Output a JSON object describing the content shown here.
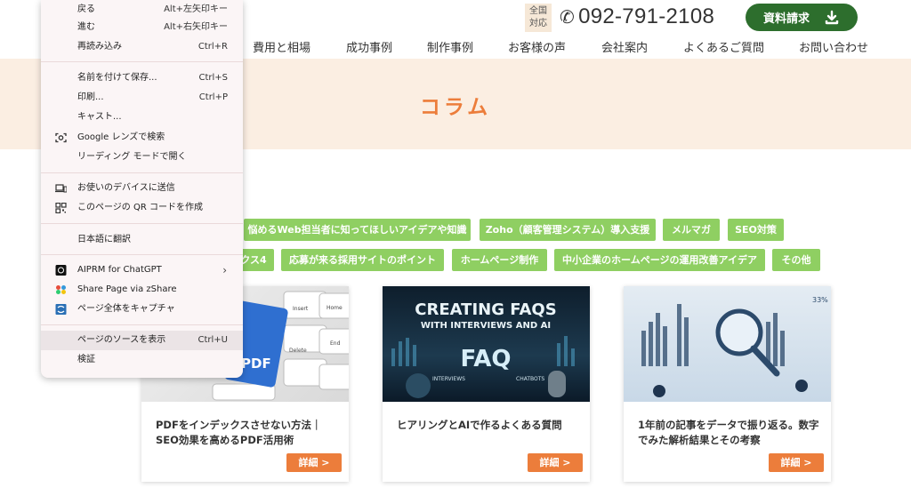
{
  "header": {
    "zenkoku": "全国\n対応",
    "zenkoku_l1": "全国",
    "zenkoku_l2": "対応",
    "phone": "092-791-2108",
    "download_label": "資料請求"
  },
  "nav": {
    "items": [
      "費用と相場",
      "成功事例",
      "制作事例",
      "お客様の声",
      "会社案内",
      "よくあるご質問",
      "お問い合わせ"
    ]
  },
  "banner": {
    "title": "コラム"
  },
  "tags": {
    "row1": [
      "悩めるWeb担当者に知ってほしいアイデアや知識",
      "Zoho（顧客管理システム）導入支援",
      "メルマガ",
      "SEO対策"
    ],
    "row2": [
      "クス4",
      "応募が来る採用サイトのポイント",
      "ホームページ制作",
      "中小企業のホームページの運用改善アイデア",
      "その他"
    ]
  },
  "cards": [
    {
      "title": "PDFをインデックスさせない方法｜SEO効果を高めるPDF活用術",
      "more": "詳細 >",
      "thumb_text": "PDF",
      "keys": [
        "Insert",
        "Home",
        "Delete",
        "End"
      ]
    },
    {
      "title": "ヒアリングとAIで作るよくある質問",
      "more": "詳細 >",
      "thumb_headline": "CREATING FAQS",
      "thumb_sub": "WITH INTERVIEWS AND AI",
      "thumb_faq": "FAQ",
      "thumb_small": "INTERVIEWS",
      "thumb_small2": "CHATBOTS"
    },
    {
      "title": "1年前の記事をデータで振り返る。数字でみた解析結果とその考察",
      "more": "詳細 >",
      "thumb_pct": "33%"
    }
  ],
  "context_menu": {
    "items": [
      {
        "label": "戻る",
        "shortcut": "Alt+左矢印キー"
      },
      {
        "label": "進む",
        "shortcut": "Alt+右矢印キー"
      },
      {
        "label": "再読み込み",
        "shortcut": "Ctrl+R"
      },
      {
        "label": "名前を付けて保存...",
        "shortcut": "Ctrl+S"
      },
      {
        "label": "印刷...",
        "shortcut": "Ctrl+P"
      },
      {
        "label": "キャスト..."
      },
      {
        "label": "Google レンズで検索",
        "icon": "google-lens-icon"
      },
      {
        "label": "リーディング モードで開く"
      },
      {
        "label": "お使いのデバイスに送信",
        "icon": "devices-icon"
      },
      {
        "label": "このページの QR コードを作成",
        "icon": "qr-code-icon"
      },
      {
        "label": "日本語に翻訳"
      },
      {
        "label": "AIPRM for ChatGPT",
        "icon": "aiprm-icon"
      },
      {
        "label": "Share Page via zShare",
        "icon": "zshare-icon"
      },
      {
        "label": "ページ全体をキャプチャ",
        "icon": "capture-icon"
      },
      {
        "label": "ページのソースを表示",
        "shortcut": "Ctrl+U"
      },
      {
        "label": "検証"
      }
    ],
    "submenu_chevron": "›"
  },
  "colors": {
    "accent_orange": "#ec7d3b",
    "tag_green": "#8fcf62",
    "button_green": "#2d6e2d",
    "banner_bg": "#fbeee2"
  }
}
